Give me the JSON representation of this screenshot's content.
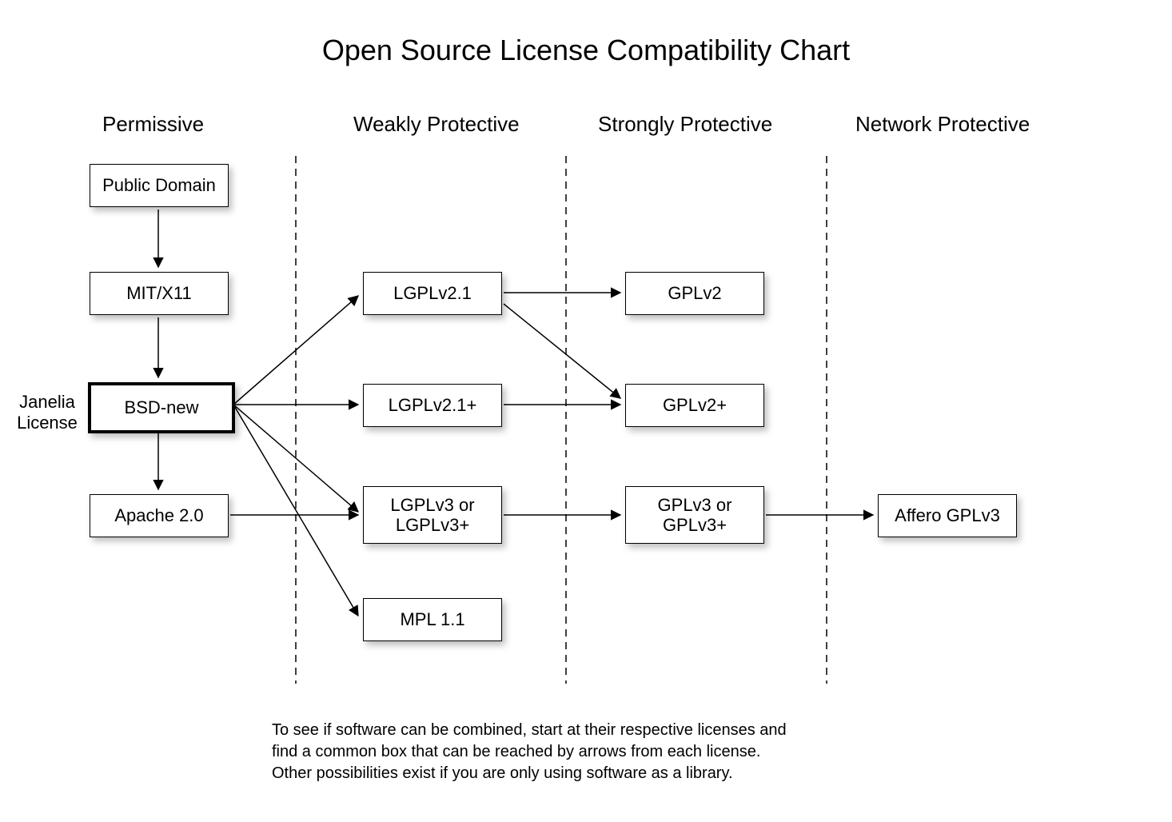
{
  "title": "Open Source License Compatibility Chart",
  "columns": {
    "permissive": "Permissive",
    "weakly": "Weakly Protective",
    "strongly": "Strongly Protective",
    "network": "Network Protective"
  },
  "side_label": {
    "line1": "Janelia",
    "line2": "License"
  },
  "nodes": {
    "public_domain": "Public Domain",
    "mit": "MIT/X11",
    "bsd": "BSD-new",
    "apache": "Apache 2.0",
    "lgpl21": "LGPLv2.1",
    "lgpl21p": "LGPLv2.1+",
    "lgpl3": "LGPLv3 or LGPLv3+",
    "mpl": "MPL 1.1",
    "gpl2": "GPLv2",
    "gpl2p": "GPLv2+",
    "gpl3": "GPLv3 or GPLv3+",
    "affero": "Affero GPLv3"
  },
  "footer": {
    "l1": "To see if software can be combined, start at their respective licenses and",
    "l2": "find a common box that can be reached by arrows from each license.",
    "l3": "Other possibilities exist if you are only using software as a library."
  },
  "chart_data": {
    "type": "diagram",
    "title": "Open Source License Compatibility Chart",
    "column_groups": [
      {
        "name": "Permissive",
        "nodes": [
          "Public Domain",
          "MIT/X11",
          "BSD-new",
          "Apache 2.0"
        ]
      },
      {
        "name": "Weakly Protective",
        "nodes": [
          "LGPLv2.1",
          "LGPLv2.1+",
          "LGPLv3 or LGPLv3+",
          "MPL 1.1"
        ]
      },
      {
        "name": "Strongly Protective",
        "nodes": [
          "GPLv2",
          "GPLv2+",
          "GPLv3 or GPLv3+"
        ]
      },
      {
        "name": "Network Protective",
        "nodes": [
          "Affero GPLv3"
        ]
      }
    ],
    "highlighted_node": "BSD-new",
    "highlighted_label": "Janelia License",
    "edges": [
      [
        "Public Domain",
        "MIT/X11"
      ],
      [
        "MIT/X11",
        "BSD-new"
      ],
      [
        "BSD-new",
        "Apache 2.0"
      ],
      [
        "BSD-new",
        "LGPLv2.1"
      ],
      [
        "BSD-new",
        "LGPLv2.1+"
      ],
      [
        "BSD-new",
        "LGPLv3 or LGPLv3+"
      ],
      [
        "BSD-new",
        "MPL 1.1"
      ],
      [
        "Apache 2.0",
        "LGPLv3 or LGPLv3+"
      ],
      [
        "LGPLv2.1",
        "GPLv2"
      ],
      [
        "LGPLv2.1",
        "GPLv2+"
      ],
      [
        "LGPLv2.1+",
        "GPLv2+"
      ],
      [
        "LGPLv3 or LGPLv3+",
        "GPLv3 or GPLv3+"
      ],
      [
        "GPLv3 or GPLv3+",
        "Affero GPLv3"
      ]
    ],
    "caption": "To see if software can be combined, start at their respective licenses and find a common box that can be reached by arrows from each license. Other possibilities exist if you are only using software as a library."
  }
}
